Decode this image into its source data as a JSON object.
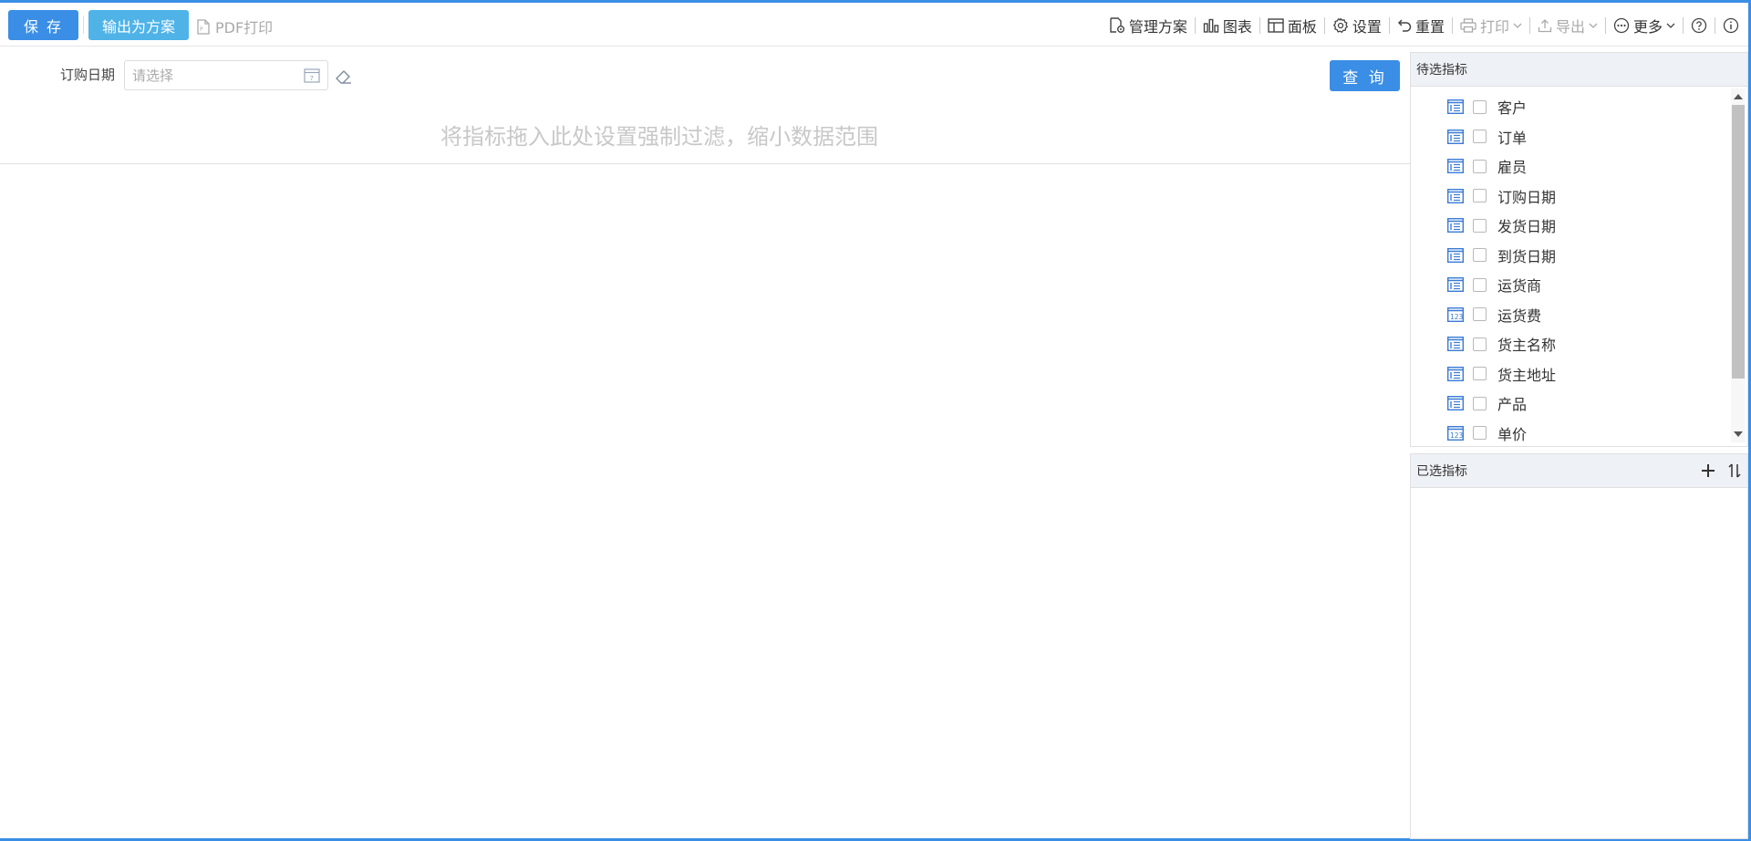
{
  "toolbar": {
    "save_label": "保 存",
    "export_plan_label": "输出为方案",
    "pdf_print_label": "PDF打印",
    "manage_plan_label": "管理方案",
    "chart_label": "图表",
    "panel_label": "面板",
    "settings_label": "设置",
    "reset_label": "重置",
    "print_label": "打印",
    "export_label": "导出",
    "more_label": "更多"
  },
  "filter": {
    "label": "订购日期",
    "placeholder": "请选择",
    "query_label": "查 询",
    "drop_hint": "将指标拖入此处设置强制过滤，缩小数据范围"
  },
  "available": {
    "title": "待选指标",
    "items": [
      {
        "label": "客户",
        "type": "text-field-icon"
      },
      {
        "label": "订单",
        "type": "text-field-icon"
      },
      {
        "label": "雇员",
        "type": "text-field-icon"
      },
      {
        "label": "订购日期",
        "type": "text-field-icon"
      },
      {
        "label": "发货日期",
        "type": "text-field-icon"
      },
      {
        "label": "到货日期",
        "type": "text-field-icon"
      },
      {
        "label": "运货商",
        "type": "text-field-icon"
      },
      {
        "label": "运货费",
        "type": "number-field-icon"
      },
      {
        "label": "货主名称",
        "type": "text-field-icon"
      },
      {
        "label": "货主地址",
        "type": "text-field-icon"
      },
      {
        "label": "产品",
        "type": "text-field-icon"
      },
      {
        "label": "单价",
        "type": "number-field-icon"
      }
    ]
  },
  "selected": {
    "title": "已选指标"
  },
  "colors": {
    "primary": "#3a8ee6",
    "secondary": "#4fb3e8"
  }
}
